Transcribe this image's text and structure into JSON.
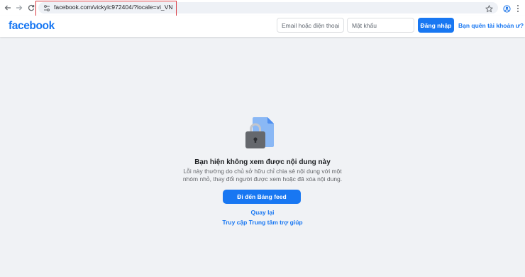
{
  "browser": {
    "url": "facebook.com/vickylc972404/?locale=vi_VN",
    "icons": [
      "back-arrow-icon",
      "forward-arrow-icon",
      "reload-icon",
      "site-info-icon",
      "star-icon",
      "profile-icon",
      "more-menu-icon"
    ]
  },
  "header": {
    "logo": "facebook",
    "email_placeholder": "Email hoặc điện thoại",
    "password_placeholder": "Mật khẩu",
    "login_label": "Đăng nhập",
    "forgot_label": "Bạn quên tài khoản ư?"
  },
  "main": {
    "title": "Bạn hiện không xem được nội dung này",
    "description": "Lỗi này thường do chủ sở hữu chỉ chia sẻ nội dung với một nhóm nhỏ, thay đổi người được xem hoặc đã xóa nội dung.",
    "feed_button": "Đi đến Bảng feed",
    "back_link": "Quay lại",
    "help_link": "Truy cập Trung tâm trợ giúp",
    "illustration_icon": "locked-document-icon"
  },
  "colors": {
    "brand": "#1877f2",
    "background": "#f0f2f5",
    "highlight_box": "#d9363e"
  }
}
